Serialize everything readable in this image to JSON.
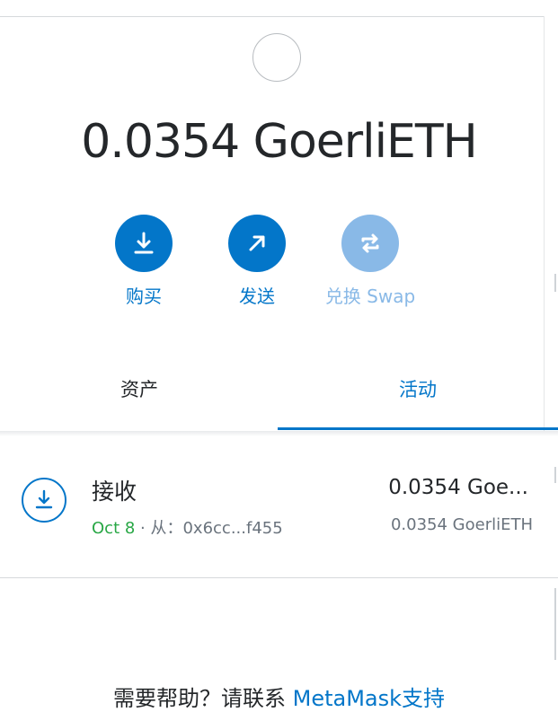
{
  "account": {
    "balance": "0.0354 GoerliETH"
  },
  "actions": [
    {
      "label": "购买",
      "icon": "download-icon",
      "enabled": true
    },
    {
      "label": "发送",
      "icon": "arrow-up-right-icon",
      "enabled": true
    },
    {
      "label": "兑换 Swap",
      "icon": "swap-icon",
      "enabled": false
    }
  ],
  "tabs": {
    "assets": "资产",
    "activity": "活动",
    "active": "activity"
  },
  "transactions": [
    {
      "title": "接收",
      "date": "Oct 8",
      "separator": " · ",
      "from_label": "从：",
      "from_address": "0x6cc...f455",
      "primary_amount": "0.0354 Goe...",
      "secondary_amount": "0.0354 GoerliETH",
      "icon": "receive-icon"
    }
  ],
  "help": {
    "prefix": "需要帮助？请联系 ",
    "link": "MetaMask支持"
  },
  "colors": {
    "primary": "#0376c9",
    "disabled": "#89b9e7",
    "date_green": "#28a745",
    "text": "#24272a",
    "muted": "#6a737d"
  }
}
